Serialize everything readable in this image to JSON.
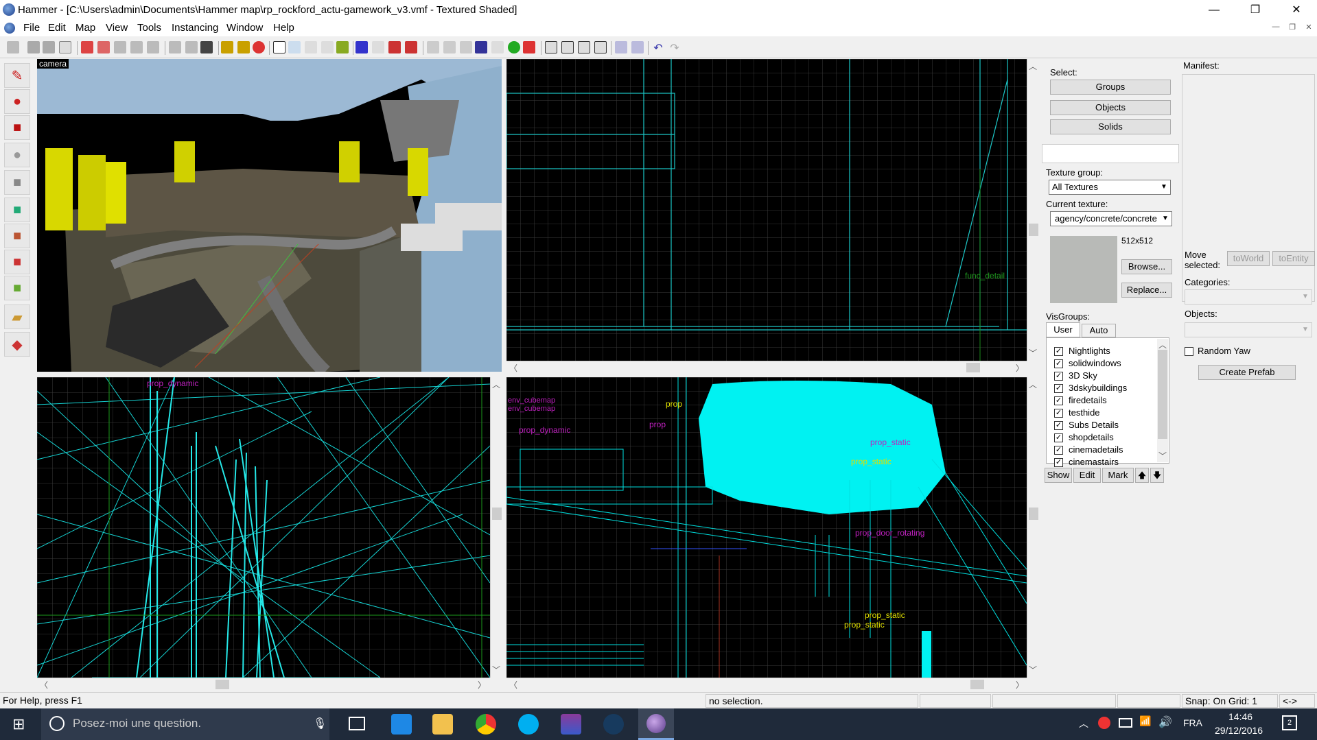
{
  "window": {
    "title": "Hammer - [C:\\Users\\admin\\Documents\\Hammer map\\rp_rockford_actu-gamework_v3.vmf - Textured Shaded]",
    "minimize": "—",
    "maximize": "❐",
    "close": "✕"
  },
  "menu": {
    "items": [
      "File",
      "Edit",
      "Map",
      "View",
      "Tools",
      "Instancing",
      "Window",
      "Help"
    ]
  },
  "viewports": {
    "camera": {
      "label": "camera"
    },
    "top_right": {
      "labels": [
        "func_detail"
      ]
    },
    "bottom_left": {
      "labels": [
        "prop_dynamic"
      ]
    },
    "bottom_right": {
      "labels": [
        "env_cubemap",
        "env_cubemap",
        "prop_dynamic",
        "prop",
        "prop",
        "prop_static",
        "prop_static",
        "prop_door_rotating",
        "prop_static",
        "prop_static"
      ]
    }
  },
  "select_panel": {
    "heading": "Select:",
    "buttons": [
      "Groups",
      "Objects",
      "Solids"
    ]
  },
  "texture": {
    "group_label": "Texture group:",
    "group_value": "All Textures",
    "current_label": "Current texture:",
    "current_value": "agency/concrete/concrete",
    "size": "512x512",
    "browse": "Browse...",
    "replace": "Replace..."
  },
  "visgroups": {
    "heading": "VisGroups:",
    "tabs": [
      "User",
      "Auto"
    ],
    "items": [
      "Nightlights",
      "solidwindows",
      "3D Sky",
      "3dskybuildings",
      "firedetails",
      "testhide",
      "Subs Details",
      "shopdetails",
      "cinemadetails",
      "cinemastairs"
    ],
    "buttons": [
      "Show",
      "Edit",
      "Mark",
      "🡅",
      "🡇"
    ]
  },
  "manifest": {
    "heading": "Manifest:",
    "move_selected": "Move selected:",
    "to_world": "toWorld",
    "to_entity": "toEntity",
    "categories": "Categories:",
    "objects": "Objects:",
    "random_yaw": "Random Yaw",
    "create_prefab": "Create Prefab"
  },
  "status": {
    "help": "For Help, press F1",
    "selection": "no selection.",
    "snap": "Snap: On Grid: 1",
    "arrows": "<->"
  },
  "taskbar": {
    "search": "Posez-moi une question.",
    "lang": "FRA",
    "time": "14:46",
    "date": "29/12/2016",
    "notif": "2"
  },
  "colors": {
    "wire": "#00e5e5",
    "grid": "#3a3a3a",
    "entity_label": "#c020c0",
    "yellow_label": "#e0e000"
  }
}
